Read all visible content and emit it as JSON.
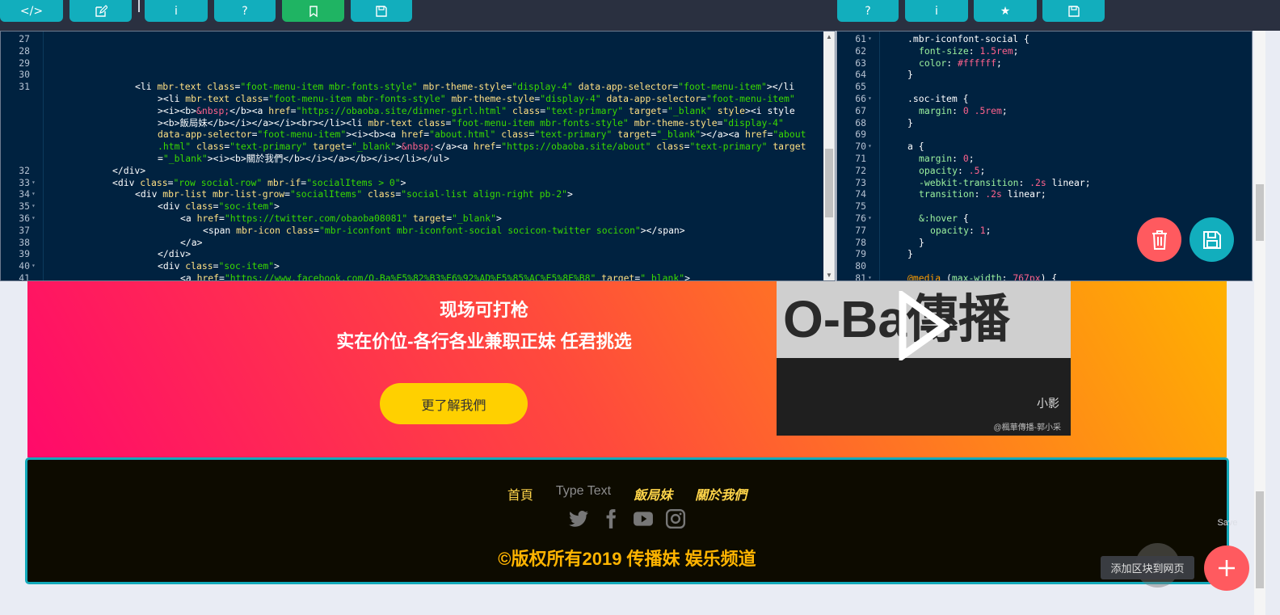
{
  "toolbar_left": [
    {
      "icon": "code-icon",
      "label": "</>"
    },
    {
      "icon": "edit-icon",
      "label": ""
    },
    {
      "icon": "info-icon",
      "label": "i"
    },
    {
      "icon": "help-icon",
      "label": "?"
    },
    {
      "icon": "bookmark-icon",
      "label": ""
    },
    {
      "icon": "save-icon",
      "label": ""
    }
  ],
  "toolbar_right": [
    {
      "icon": "help-icon",
      "label": "?"
    },
    {
      "icon": "info-icon",
      "label": "i"
    },
    {
      "icon": "star-icon",
      "label": "★"
    },
    {
      "icon": "save-icon",
      "label": ""
    }
  ],
  "html_editor": {
    "line_numbers": [
      "27",
      "28",
      "29",
      "30",
      "31",
      "",
      "",
      "",
      "",
      "",
      "",
      "32",
      "33",
      "34",
      "35",
      "36",
      "37",
      "38",
      "39",
      "40",
      "41"
    ],
    "foldable": [
      "",
      "",
      "",
      "",
      "",
      "",
      "",
      "",
      "",
      "",
      "",
      "",
      "▾",
      "▾",
      "▾",
      "▾",
      "",
      "",
      "",
      "▾",
      ""
    ]
  },
  "css_editor": {
    "line_numbers": [
      "61",
      "62",
      "63",
      "64",
      "65",
      "66",
      "67",
      "68",
      "69",
      "70",
      "71",
      "72",
      "73",
      "74",
      "75",
      "76",
      "77",
      "78",
      "79",
      "80",
      "81"
    ],
    "foldable": [
      "▾",
      "",
      "",
      "",
      "",
      "▾",
      "",
      "",
      "",
      "▾",
      "",
      "",
      "",
      "",
      "",
      "▾",
      "",
      "",
      "",
      "",
      "▾"
    ]
  },
  "hero": {
    "line1": "现场可打枪",
    "line2": "实在价位-各行各业兼职正妹 任君挑选",
    "button": "更了解我們"
  },
  "video": {
    "logo_text": "O-Ba傳播",
    "watermark": "小影",
    "caption": "@楓華傳播-郭小采"
  },
  "footer": {
    "nav": [
      "首頁",
      "Type Text",
      "飯局妹",
      "關於我們"
    ],
    "social": [
      "twitter-icon",
      "facebook-icon",
      "youtube-icon",
      "instagram-icon"
    ],
    "copyright": "©版权所有2019 传播妹 娱乐频道"
  },
  "add_block_tooltip": "添加区块到网页",
  "ghost_save": "Save",
  "colors": {
    "accent": "#12aebd",
    "green": "#1fb463",
    "delete": "#ff5a5f",
    "editor_bg": "#002240"
  }
}
